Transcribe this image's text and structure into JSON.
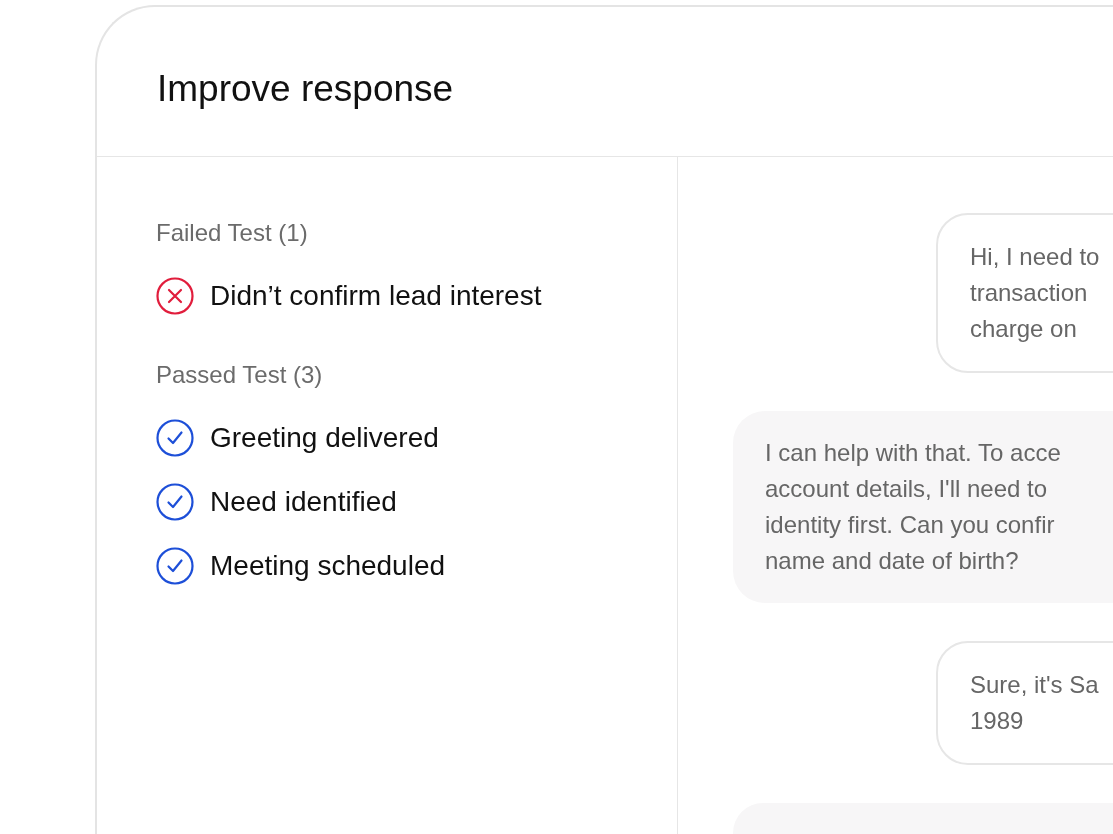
{
  "panel": {
    "title": "Improve response"
  },
  "test_groups": [
    {
      "heading": "Failed Test (1)",
      "tests": [
        {
          "label": "Didn’t confirm lead interest",
          "kind": "failed"
        }
      ]
    },
    {
      "heading": "Passed Test (3)",
      "tests": [
        {
          "label": "Greeting delivered",
          "kind": "passed"
        },
        {
          "label": "Need identified",
          "kind": "passed"
        },
        {
          "label": "Meeting scheduled",
          "kind": "passed"
        }
      ]
    }
  ],
  "messages": [
    {
      "kind": "user",
      "text": "Hi, I need to\ntransaction\ncharge on"
    },
    {
      "kind": "agent",
      "text": "I can help with that. To acce\naccount details, I'll need to\nidentity first. Can you confir\nname and date of birth?"
    },
    {
      "kind": "user",
      "text": "Sure, it's Sa\n1989"
    },
    {
      "kind": "agent"
    }
  ]
}
